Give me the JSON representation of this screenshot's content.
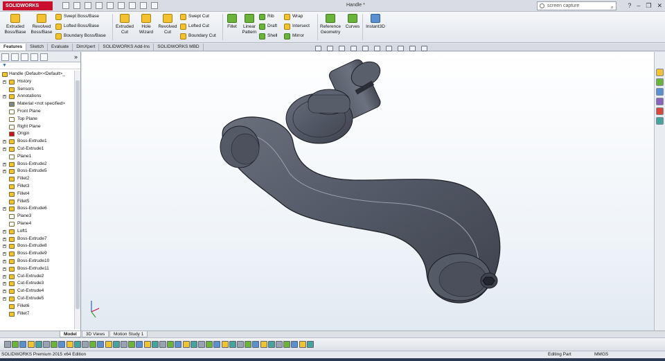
{
  "app": {
    "logo_text": "SOLIDWORKS",
    "document_title": "Handle *",
    "search_placeholder": "screen capture",
    "brand_color": "#c8102e"
  },
  "ribbon": {
    "extruded_boss": "Extruded Boss/Base",
    "revolved_boss": "Revolved Boss/Base",
    "swept_boss": "Swept Boss/Base",
    "lofted_boss": "Lofted Boss/Base",
    "boundary_boss": "Boundary Boss/Base",
    "extruded_cut": "Extruded Cut",
    "hole_wizard": "Hole Wizard",
    "revolved_cut": "Revolved Cut",
    "swept_cut": "Swept Cut",
    "lofted_cut": "Lofted Cut",
    "boundary_cut": "Boundary Cut",
    "fillet": "Fillet",
    "linear_pattern": "Linear Pattern",
    "rib": "Rib",
    "draft": "Draft",
    "shell": "Shell",
    "wrap": "Wrap",
    "intersect": "Intersect",
    "mirror": "Mirror",
    "reference_geometry": "Reference Geometry",
    "curves": "Curves",
    "instant3d": "Instant3D"
  },
  "tabs": [
    "Features",
    "Sketch",
    "Evaluate",
    "DimXpert",
    "SOLIDWORKS Add-Ins",
    "SOLIDWORKS MBD"
  ],
  "tree": [
    {
      "label": "Handle  (Default<<Default>_",
      "icon": "part-icon",
      "expand": "",
      "root": true
    },
    {
      "label": "History",
      "icon": "history-icon",
      "expand": "+"
    },
    {
      "label": "Sensors",
      "icon": "sensor-icon",
      "expand": ""
    },
    {
      "label": "Annotations",
      "icon": "annotation-icon",
      "expand": "+"
    },
    {
      "label": "Material <not specified>",
      "icon": "material-icon",
      "expand": ""
    },
    {
      "label": "Front Plane",
      "icon": "plane-icon",
      "expand": ""
    },
    {
      "label": "Top Plane",
      "icon": "plane-icon",
      "expand": ""
    },
    {
      "label": "Right Plane",
      "icon": "plane-icon",
      "expand": ""
    },
    {
      "label": "Origin",
      "icon": "origin-icon",
      "expand": ""
    },
    {
      "label": "Boss-Extrude1",
      "icon": "feature-icon",
      "expand": "+"
    },
    {
      "label": "Cut-Extrude1",
      "icon": "feature-icon",
      "expand": "+"
    },
    {
      "label": "Plane1",
      "icon": "plane-icon",
      "expand": ""
    },
    {
      "label": "Boss-Extrude2",
      "icon": "feature-icon",
      "expand": "+"
    },
    {
      "label": "Boss-Extrude5",
      "icon": "feature-icon",
      "expand": "+"
    },
    {
      "label": "Fillet2",
      "icon": "fillet-icon",
      "expand": ""
    },
    {
      "label": "Fillet3",
      "icon": "fillet-icon",
      "expand": ""
    },
    {
      "label": "Fillet4",
      "icon": "fillet-icon",
      "expand": ""
    },
    {
      "label": "Fillet5",
      "icon": "fillet-icon",
      "expand": ""
    },
    {
      "label": "Boss-Extrude6",
      "icon": "feature-icon",
      "expand": "+"
    },
    {
      "label": "Plane3",
      "icon": "plane-icon",
      "expand": ""
    },
    {
      "label": "Plane4",
      "icon": "plane-icon",
      "expand": ""
    },
    {
      "label": "Loft1",
      "icon": "feature-icon",
      "expand": "+"
    },
    {
      "label": "Boss-Extrude7",
      "icon": "feature-icon",
      "expand": "+"
    },
    {
      "label": "Boss-Extrude8",
      "icon": "feature-icon",
      "expand": "+"
    },
    {
      "label": "Boss-Extrude9",
      "icon": "feature-icon",
      "expand": "+"
    },
    {
      "label": "Boss-Extrude10",
      "icon": "feature-icon",
      "expand": "+"
    },
    {
      "label": "Boss-Extrude11",
      "icon": "feature-icon",
      "expand": "+"
    },
    {
      "label": "Cut-Extrude2",
      "icon": "feature-icon",
      "expand": "+"
    },
    {
      "label": "Cut-Extrude3",
      "icon": "feature-icon",
      "expand": "+"
    },
    {
      "label": "Cut-Extrude4",
      "icon": "feature-icon",
      "expand": "+"
    },
    {
      "label": "Cut-Extrude5",
      "icon": "feature-icon",
      "expand": "+"
    },
    {
      "label": "Fillet6",
      "icon": "fillet-icon",
      "expand": ""
    },
    {
      "label": "Fillet7",
      "icon": "fillet-icon",
      "expand": ""
    }
  ],
  "bottom_tabs": [
    "Model",
    "3D Views",
    "Motion Study 1"
  ],
  "status": {
    "edition": "SOLIDWORKS Premium 2015 x64 Edition",
    "mode": "Editing Part",
    "units": "MMGS"
  }
}
